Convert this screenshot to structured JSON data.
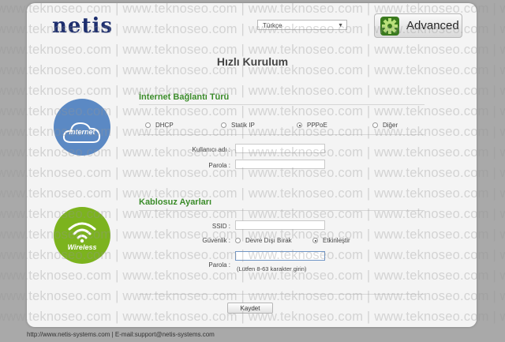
{
  "header": {
    "logo_text": "netis",
    "language_select": "Türkçe",
    "advanced_button": "Advanced"
  },
  "page_title": "Hızlı Kurulum",
  "internet": {
    "section_title": "İnternet Bağlantı Türü",
    "icon_caption": "Internet",
    "connection_types": [
      {
        "label": "DHCP",
        "checked": false
      },
      {
        "label": "Statik IP",
        "checked": false
      },
      {
        "label": "PPPoE",
        "checked": true
      },
      {
        "label": "Diğer",
        "checked": false
      }
    ],
    "username_label": "Kullanıcı adı :",
    "username_value": "",
    "password_label": "Parola :",
    "password_value": ""
  },
  "wireless": {
    "section_title": "Kablosuz Ayarları",
    "icon_caption": "Wireless",
    "ssid_label": "SSID :",
    "ssid_value": "",
    "security_label": "Güvenlik :",
    "security_options": [
      {
        "label": "Devre Dışı Bırak",
        "checked": false
      },
      {
        "label": "Etkinleştir",
        "checked": true
      }
    ],
    "password_label": "Parola :",
    "password_value": "",
    "password_hint": "(Lütfen 8-63 karakter girin)"
  },
  "save_button": "Kaydet",
  "footer": {
    "site": "http://www.netis-systems.com",
    "separator": "|",
    "email": "E-mail:support@netis-systems.com"
  },
  "watermark_text": "www.teknoseo.com | www.teknoseo.com | www.teknoseo.com | www.teknoseo.com | www.teknoseo.com | www.teknoseo.com",
  "colors": {
    "accent_green": "#3b8c2a",
    "internet_blue": "#5b89c4",
    "wireless_green": "#7cb31e",
    "logo_navy": "#1d2e6e"
  },
  "icons": [
    "gear-icon",
    "internet-cloud-icon",
    "wireless-signal-icon",
    "chevron-down-icon"
  ]
}
